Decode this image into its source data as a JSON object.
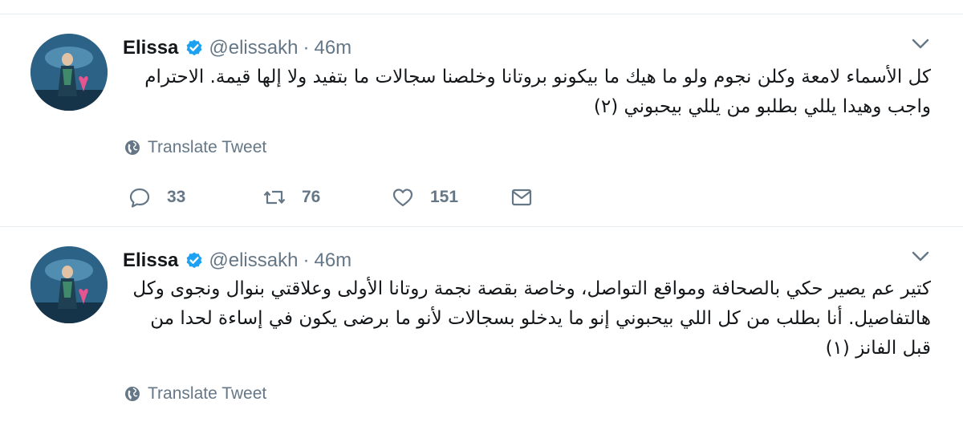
{
  "tweets": [
    {
      "name": "Elissa",
      "handle": "@elissakh",
      "separator": "·",
      "time": "46m",
      "text": "كل الأسماء لامعة وكلن نجوم ولو ما هيك ما بيكونو بروتانا وخلصنا سجالات ما بتفيد ولا إلها قيمة. الاحترام واجب وهيدا يللي بطلبو من يللي بيحبوني (٢)",
      "translate": "Translate Tweet",
      "replies": "33",
      "retweets": "76",
      "likes": "151"
    },
    {
      "name": "Elissa",
      "handle": "@elissakh",
      "separator": "·",
      "time": "46m",
      "text": "كتير عم يصير حكي بالصحافة ومواقع التواصل، وخاصة بقصة نجمة روتانا الأولى وعلاقتي بنوال ونجوى وكل هالتفاصيل. أنا بطلب من كل اللي بيحبوني إنو ما يدخلو بسجالات لأنو ما برضى يكون في إساءة لحدا من قبل الفانز (١)",
      "translate": "Translate Tweet"
    }
  ],
  "colors": {
    "verified": "#1da1f2",
    "secondary": "#657786",
    "text": "#14171a",
    "divider": "#e6ecf0"
  },
  "icons": [
    "verified-badge-icon",
    "chevron-down-icon",
    "globe-icon",
    "reply-icon",
    "retweet-icon",
    "heart-icon",
    "direct-message-icon"
  ]
}
